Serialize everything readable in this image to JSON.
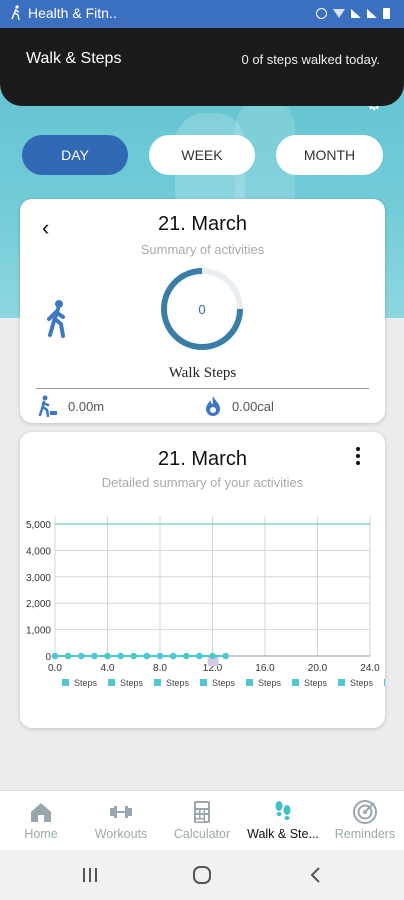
{
  "status_bar": {
    "app_title": "Health & Fitn.."
  },
  "toast": {
    "title": "Walk & Steps",
    "message": "0 of steps walked today."
  },
  "period_tabs": [
    {
      "label": "DAY",
      "selected": true
    },
    {
      "label": "WEEK",
      "selected": false
    },
    {
      "label": "MONTH",
      "selected": false
    }
  ],
  "summary_card": {
    "date": "21. March",
    "subtitle": "Summary of activities",
    "steps_value": "0",
    "steps_label": "Walk Steps",
    "distance": "0.00m",
    "calories": "0.00cal"
  },
  "detail_card": {
    "date": "21. March",
    "subtitle": "Detailed summary of your activities"
  },
  "chart_data": {
    "type": "line",
    "title": "",
    "x_ticks": [
      "0.0",
      "4.0",
      "8.0",
      "12.0",
      "16.0",
      "20.0",
      "24.0"
    ],
    "y_ticks": [
      "0",
      "1,000",
      "2,000",
      "3,000",
      "4,000",
      "5,000"
    ],
    "xlim": [
      0,
      24
    ],
    "ylim": [
      0,
      5000
    ],
    "series": [
      {
        "name": "Steps",
        "color": "#4fc7cf",
        "x": [
          0,
          1,
          2,
          3,
          4,
          5,
          6,
          7,
          8,
          9,
          10,
          11,
          12,
          13
        ],
        "values": [
          0,
          0,
          0,
          0,
          0,
          0,
          0,
          0,
          0,
          0,
          0,
          0,
          0,
          0
        ]
      }
    ],
    "goal_line": {
      "value": 5000,
      "color": "#6fd1b8"
    },
    "legend_labels": [
      "Steps",
      "Steps",
      "Steps",
      "Steps",
      "Steps",
      "Steps",
      "Steps"
    ],
    "legend_placement": "bottom",
    "grid": true
  },
  "bottom_nav": [
    {
      "label": "Home",
      "icon": "home-icon",
      "active": false
    },
    {
      "label": "Workouts",
      "icon": "dumbbell-icon",
      "active": false
    },
    {
      "label": "Calculator",
      "icon": "calculator-icon",
      "active": false
    },
    {
      "label": "Walk & Ste...",
      "icon": "footprints-icon",
      "active": true
    },
    {
      "label": "Reminders",
      "icon": "target-icon",
      "active": false
    }
  ],
  "colors": {
    "accent": "#3169b4",
    "hero": "#6fcad6",
    "chart_line": "#4fc7cf",
    "goal_line": "#6fd1b8"
  }
}
